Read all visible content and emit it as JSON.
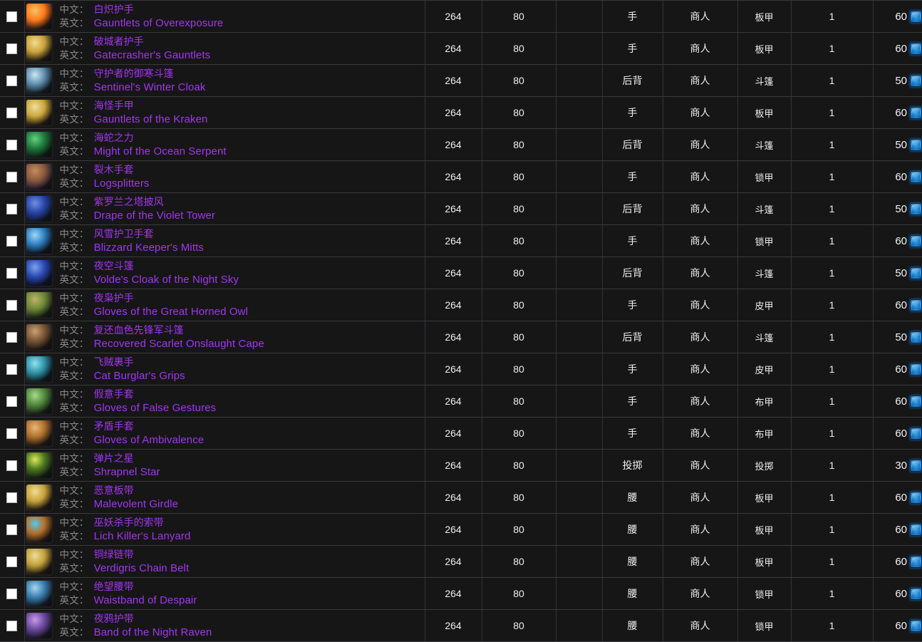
{
  "table": {
    "labels": {
      "zh_label": "中文：",
      "en_label": "英文："
    },
    "columns": [
      "checkbox",
      "name",
      "item_level",
      "required_level",
      "blank",
      "slot",
      "source",
      "armor_type",
      "count",
      "cost"
    ],
    "accent_colors": {
      "epic_purple": "#a335ee",
      "label_gray": "#8a8a8a",
      "row_bg": "#161617",
      "border": "#3a3a3c",
      "emblem_blue": "#1470c4"
    },
    "rows": [
      {
        "zh": "白炽护手",
        "en": "Gauntlets of Overexposure",
        "item_level": "264",
        "required_level": "80",
        "blank": "",
        "slot": "手",
        "source": "商人",
        "armor_type": "板甲",
        "count": "1",
        "cost": "60",
        "icon_colors": [
          "#3a1c10",
          "#ff7a18",
          "#f2c36b",
          "#5b3a7a"
        ]
      },
      {
        "zh": "破城者护手",
        "en": "Gatecrasher's Gauntlets",
        "item_level": "264",
        "required_level": "80",
        "blank": "",
        "slot": "手",
        "source": "商人",
        "armor_type": "板甲",
        "count": "1",
        "cost": "60",
        "icon_colors": [
          "#2a2110",
          "#c9a13a",
          "#f3dd8c",
          "#6b5a22"
        ]
      },
      {
        "zh": "守护者的御寒斗篷",
        "en": "Sentinel's Winter Cloak",
        "item_level": "264",
        "required_level": "80",
        "blank": "",
        "slot": "后背",
        "source": "商人",
        "armor_type": "斗篷",
        "count": "1",
        "cost": "50",
        "icon_colors": [
          "#17232e",
          "#5f8fae",
          "#cfe5f2",
          "#2b4a63"
        ]
      },
      {
        "zh": "海怪手甲",
        "en": "Gauntlets of the Kraken",
        "item_level": "264",
        "required_level": "80",
        "blank": "",
        "slot": "手",
        "source": "商人",
        "armor_type": "板甲",
        "count": "1",
        "cost": "60",
        "icon_colors": [
          "#2b220f",
          "#caa63c",
          "#f0e0a0",
          "#6f5c24"
        ]
      },
      {
        "zh": "海蛇之力",
        "en": "Might of the Ocean Serpent",
        "item_level": "264",
        "required_level": "80",
        "blank": "",
        "slot": "后背",
        "source": "商人",
        "armor_type": "斗篷",
        "count": "1",
        "cost": "50",
        "icon_colors": [
          "#0e2416",
          "#1f7a3c",
          "#5fd27f",
          "#0a3f1f"
        ]
      },
      {
        "zh": "裂木手套",
        "en": "Logsplitters",
        "item_level": "264",
        "required_level": "80",
        "blank": "",
        "slot": "手",
        "source": "商人",
        "armor_type": "锁甲",
        "count": "1",
        "cost": "60",
        "icon_colors": [
          "#241a2e",
          "#8a5a3c",
          "#c88a5c",
          "#3d2a52"
        ]
      },
      {
        "zh": "紫罗兰之塔披风",
        "en": "Drape of the Violet Tower",
        "item_level": "264",
        "required_level": "80",
        "blank": "",
        "slot": "后背",
        "source": "商人",
        "armor_type": "斗篷",
        "count": "1",
        "cost": "50",
        "icon_colors": [
          "#101a36",
          "#2746a8",
          "#6f90e0",
          "#0b1026"
        ]
      },
      {
        "zh": "风雪护卫手套",
        "en": "Blizzard Keeper's Mitts",
        "item_level": "264",
        "required_level": "80",
        "blank": "",
        "slot": "手",
        "source": "商人",
        "armor_type": "锁甲",
        "count": "1",
        "cost": "60",
        "icon_colors": [
          "#0e1d2c",
          "#2e7fc0",
          "#9fd8f5",
          "#183247"
        ]
      },
      {
        "zh": "夜空斗篷",
        "en": "Volde's Cloak of the Night Sky",
        "item_level": "264",
        "required_level": "80",
        "blank": "",
        "slot": "后背",
        "source": "商人",
        "armor_type": "斗篷",
        "count": "1",
        "cost": "50",
        "icon_colors": [
          "#0d1538",
          "#2a4bb5",
          "#7ea0ea",
          "#0a0f28"
        ]
      },
      {
        "zh": "夜枭护手",
        "en": "Gloves of the Great Horned Owl",
        "item_level": "264",
        "required_level": "80",
        "blank": "",
        "slot": "手",
        "source": "商人",
        "armor_type": "皮甲",
        "count": "1",
        "cost": "60",
        "icon_colors": [
          "#1f2a12",
          "#6e8a36",
          "#c0b26a",
          "#8a6f9a"
        ]
      },
      {
        "zh": "复还血色先锋军斗篷",
        "en": "Recovered Scarlet Onslaught Cape",
        "item_level": "264",
        "required_level": "80",
        "blank": "",
        "slot": "后背",
        "source": "商人",
        "armor_type": "斗篷",
        "count": "1",
        "cost": "50",
        "icon_colors": [
          "#241a12",
          "#7a5636",
          "#c9a173",
          "#3a2a1c"
        ]
      },
      {
        "zh": "飞贼裹手",
        "en": "Cat Burglar's Grips",
        "item_level": "264",
        "required_level": "80",
        "blank": "",
        "slot": "手",
        "source": "商人",
        "armor_type": "皮甲",
        "count": "1",
        "cost": "60",
        "icon_colors": [
          "#10222a",
          "#2f93a8",
          "#8fe3ef",
          "#1c3a46"
        ]
      },
      {
        "zh": "假意手套",
        "en": "Gloves of False Gestures",
        "item_level": "264",
        "required_level": "80",
        "blank": "",
        "slot": "手",
        "source": "商人",
        "armor_type": "布甲",
        "count": "1",
        "cost": "60",
        "icon_colors": [
          "#1b2a14",
          "#4f8a3c",
          "#a8d98c",
          "#7a3a52"
        ]
      },
      {
        "zh": "矛盾手套",
        "en": "Gloves of Ambivalence",
        "item_level": "264",
        "required_level": "80",
        "blank": "",
        "slot": "手",
        "source": "商人",
        "armor_type": "布甲",
        "count": "1",
        "cost": "60",
        "icon_colors": [
          "#2a1c10",
          "#b0702c",
          "#e8b878",
          "#5a3c1e"
        ]
      },
      {
        "zh": "弹片之星",
        "en": "Shrapnel Star",
        "item_level": "264",
        "required_level": "80",
        "blank": "",
        "slot": "投掷",
        "source": "商人",
        "armor_type": "投掷",
        "count": "1",
        "cost": "30",
        "icon_colors": [
          "#17240f",
          "#4e7a20",
          "#d8e85c",
          "#2b3d14"
        ]
      },
      {
        "zh": "恶意板带",
        "en": "Malevolent Girdle",
        "item_level": "264",
        "required_level": "80",
        "blank": "",
        "slot": "腰",
        "source": "商人",
        "armor_type": "板甲",
        "count": "1",
        "cost": "60",
        "icon_colors": [
          "#2b2110",
          "#c6a33c",
          "#f0dd94",
          "#6a5420"
        ]
      },
      {
        "zh": "巫妖杀手的索带",
        "en": "Lich Killer's Lanyard",
        "item_level": "264",
        "required_level": "80",
        "blank": "",
        "slot": "腰",
        "source": "商人",
        "armor_type": "板甲",
        "count": "1",
        "cost": "60",
        "icon_colors": [
          "#2e1d0f",
          "#b5702a",
          "#58c8e8",
          "#1e4a66"
        ]
      },
      {
        "zh": "铜绿链带",
        "en": "Verdigris Chain Belt",
        "item_level": "264",
        "required_level": "80",
        "blank": "",
        "slot": "腰",
        "source": "商人",
        "armor_type": "板甲",
        "count": "1",
        "cost": "60",
        "icon_colors": [
          "#2b2310",
          "#c2a23c",
          "#eedc96",
          "#6a5822"
        ]
      },
      {
        "zh": "绝望腰带",
        "en": "Waistband of Despair",
        "item_level": "264",
        "required_level": "80",
        "blank": "",
        "slot": "腰",
        "source": "商人",
        "armor_type": "锁甲",
        "count": "1",
        "cost": "60",
        "icon_colors": [
          "#132232",
          "#3a7fae",
          "#a6d6ee",
          "#20415a"
        ]
      },
      {
        "zh": "夜鸦护带",
        "en": "Band of the Night Raven",
        "item_level": "264",
        "required_level": "80",
        "blank": "",
        "slot": "腰",
        "source": "商人",
        "armor_type": "锁甲",
        "count": "1",
        "cost": "60",
        "icon_colors": [
          "#1e1830",
          "#6b4aa0",
          "#c79ae8",
          "#2e2448"
        ]
      }
    ]
  }
}
